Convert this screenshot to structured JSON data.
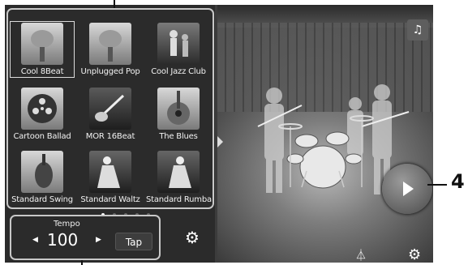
{
  "styles": [
    {
      "label": "Cool 8Beat",
      "icon": "microphone-icon",
      "selected": true
    },
    {
      "label": "Unplugged Pop",
      "icon": "microphone-icon"
    },
    {
      "label": "Cool Jazz Club",
      "icon": "jazz-band-icon"
    },
    {
      "label": "Cartoon Ballad",
      "icon": "film-reel-icon"
    },
    {
      "label": "MOR 16Beat",
      "icon": "guitar-icon"
    },
    {
      "label": "The Blues",
      "icon": "acoustic-guitar-icon"
    },
    {
      "label": "Standard Swing",
      "icon": "violin-icon"
    },
    {
      "label": "Standard Waltz",
      "icon": "dancers-icon"
    },
    {
      "label": "Standard Rumba",
      "icon": "dancers-icon"
    }
  ],
  "pagination": {
    "pages": 5,
    "current": 1
  },
  "tempo": {
    "label": "Tempo",
    "value": "100",
    "tap_label": "Tap"
  },
  "callouts": {
    "play": "4"
  }
}
